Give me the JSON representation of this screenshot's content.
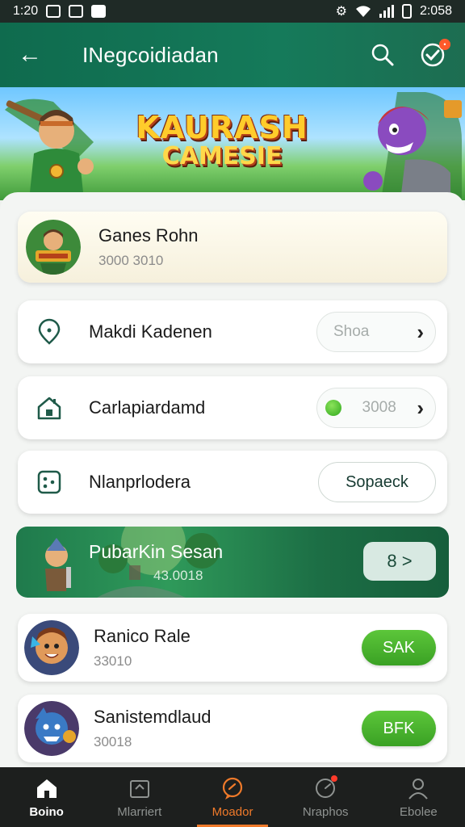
{
  "status_bar": {
    "time_left": "1:20",
    "time_right": "2:058"
  },
  "app_bar": {
    "title": "INegcoidiadan"
  },
  "banner": {
    "logo_line1": "KAURASH",
    "logo_line2": "CAMESIE"
  },
  "featured": {
    "title": "Ganes Rohn",
    "subtitle": "3000 3010"
  },
  "rows": [
    {
      "label": "Makdi Kadenen",
      "value": "Shoa"
    },
    {
      "label": "Carlapiardamd",
      "value": "3008"
    },
    {
      "label": "Nlanprlodera",
      "button": "Sopaeck"
    }
  ],
  "promo": {
    "title": "PubarKin Sesan",
    "subtitle": "43.0018",
    "button": "8 >"
  },
  "games": [
    {
      "title": "Ranico Rale",
      "subtitle": "33010",
      "button": "SAK"
    },
    {
      "title": "Sanistemdlaud",
      "subtitle": "30018",
      "button": "BFK"
    }
  ],
  "nav": [
    {
      "label": "Boino"
    },
    {
      "label": "Mlarriert"
    },
    {
      "label": "Moador"
    },
    {
      "label": "Nraphos"
    },
    {
      "label": "Ebolee"
    }
  ],
  "colors": {
    "primary": "#157a5a",
    "accent": "#f07a2a",
    "action": "#3aa124",
    "nav_bg": "#1d1f1e"
  }
}
